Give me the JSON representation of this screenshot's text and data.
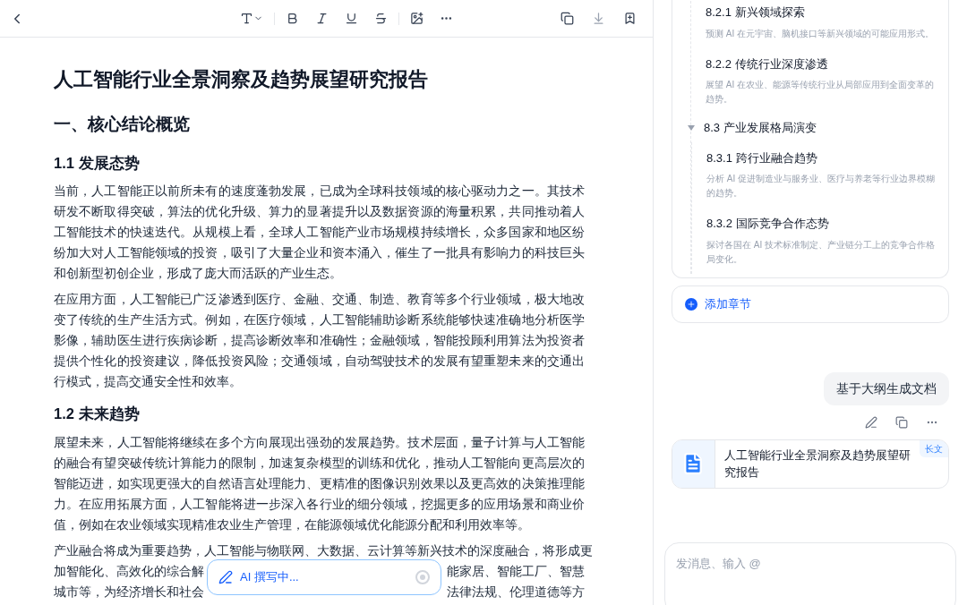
{
  "document": {
    "title": "人工智能行业全景洞察及趋势展望研究报告",
    "blocks": [
      {
        "kind": "h1",
        "text": "一、核心结论概览"
      },
      {
        "kind": "h2",
        "text": "1.1 发展态势"
      },
      {
        "kind": "p",
        "text": "当前，人工智能正以前所未有的速度蓬勃发展，已成为全球科技领域的核心驱动力之一。其技术研发不断取得突破，算法的优化升级、算力的显著提升以及数据资源的海量积累，共同推动着人工智能技术的快速迭代。从规模上看，全球人工智能产业市场规模持续增长，众多国家和地区纷纷加大对人工智能领域的投资，吸引了大量企业和资本涌入，催生了一批具有影响力的科技巨头和创新型初创企业，形成了庞大而活跃的产业生态。"
      },
      {
        "kind": "p",
        "text": "在应用方面，人工智能已广泛渗透到医疗、金融、交通、制造、教育等多个行业领域，极大地改变了传统的生产生活方式。例如，在医疗领域，人工智能辅助诊断系统能够快速准确地分析医学影像，辅助医生进行疾病诊断，提高诊断效率和准确性；金融领域，智能投顾利用算法为投资者提供个性化的投资建议，降低投资风险；交通领域，自动驾驶技术的发展有望重塑未来的交通出行模式，提高交通安全性和效率。"
      },
      {
        "kind": "h2",
        "text": "1.2 未来趋势"
      },
      {
        "kind": "p",
        "text": "展望未来，人工智能将继续在多个方向展现出强劲的发展趋势。技术层面，量子计算与人工智能的融合有望突破传统计算能力的限制，加速复杂模型的训练和优化，推动人工智能向更高层次的智能迈进，如实现更强大的自然语言处理能力、更精准的图像识别效果以及更高效的决策推理能力。在应用拓展方面，人工智能将进一步深入各行业的细分领域，挖掘更多的应用场景和商业价值，例如在农业领域实现精准农业生产管理，在能源领域优化能源分配和利用效率等。"
      },
      {
        "kind": "lines",
        "lines": [
          {
            "left": "产业融合将成为重要趋势，人工智能与物联网、大数据、云计算等新兴技术的深度融合，将形成更"
          },
          {
            "left": "加智能化、高效化的综合解",
            "right": "能家居、智能工厂、智慧"
          },
          {
            "left": "城市等，为经济增长和社会",
            "right": "法律法规、伦理道德等方"
          }
        ]
      }
    ]
  },
  "ai_status": {
    "text": "AI 撰写中..."
  },
  "outline": {
    "items": [
      {
        "title": "8.2.1 新兴领域探索",
        "description": "预测 AI 在元宇宙、脑机接口等新兴领域的可能应用形式。"
      },
      {
        "title": "8.2.2 传统行业深度渗透",
        "description": "展望 AI 在农业、能源等传统行业从局部应用到全面变革的趋势。"
      },
      {
        "title": "8.3 产业发展格局演变",
        "expanded": true,
        "children": [
          {
            "title": "8.3.1 跨行业融合趋势",
            "description": "分析 AI 促进制造业与服务业、医疗与养老等行业边界模糊的趋势。"
          },
          {
            "title": "8.3.2 国际竞争合作态势",
            "description": "探讨各国在 AI 技术标准制定、产业链分工上的竞争合作格局变化。"
          }
        ]
      }
    ]
  },
  "add_section": "添加章节",
  "user_message": "基于大纲生成文档",
  "doc_card": {
    "title": "人工智能行业全景洞察及趋势展望研究报告",
    "badge": "长文"
  },
  "chat_input": {
    "placeholder": "发消息、输入 @"
  }
}
